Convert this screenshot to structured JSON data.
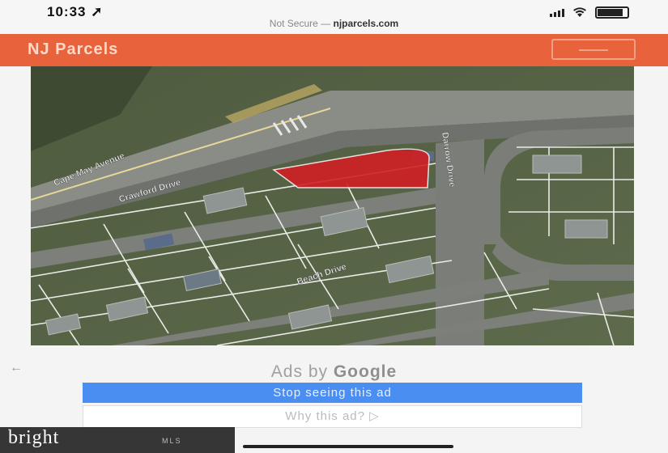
{
  "status": {
    "time": "10:33",
    "url_prefix": "Not Secure —",
    "url_domain": "njparcels.com"
  },
  "header": {
    "title": "NJ Parcels"
  },
  "map": {
    "road_labels": [
      "Cape May Avenue",
      "Crawford Drive",
      "Darrow Drive",
      "Beach Drive"
    ]
  },
  "ads": {
    "label_prefix": "Ads by",
    "label_brand": "Google",
    "stop_button": "Stop seeing this ad",
    "why_button": "Why this ad? ▷"
  },
  "watermark": {
    "logo": "bright",
    "sub": "MLS"
  },
  "colors": {
    "header_bg": "#e8623c",
    "parcel_highlight": "#d11f24",
    "ad_button": "#4a8ef1"
  }
}
